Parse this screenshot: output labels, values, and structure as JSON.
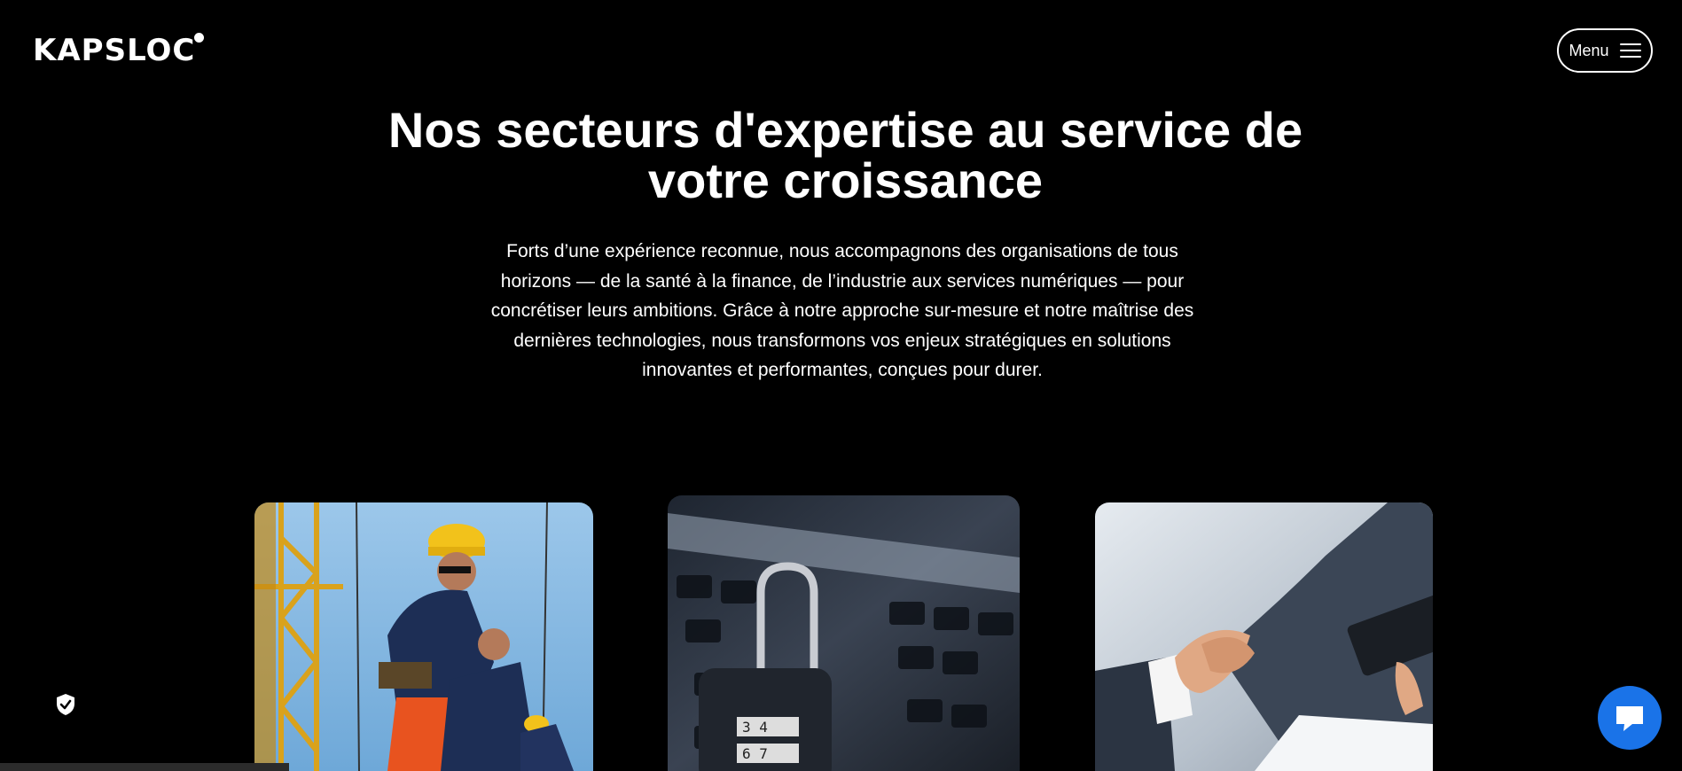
{
  "header": {
    "logo_text": "KAPSLOC",
    "menu_label": "Menu"
  },
  "hero": {
    "title_line1": "Nos secteurs d'expertise au service de",
    "title_line2": "votre croissance",
    "intro": "Forts d’une expérience reconnue, nous accompagnons des organisations de tous horizons — de la santé à la finance, de l’industrie aux services numériques — pour concrétiser leurs ambitions. Grâce à notre approche sur-mesure et notre maîtrise des dernières technologies, nous transformons vos enjeux stratégiques en solutions innovantes et performantes, conçues pour durer."
  },
  "cards": [
    {
      "image": "construction-workers-crane-photo"
    },
    {
      "image": "padlock-on-laptop-keyboard-photo"
    },
    {
      "image": "business-handshake-photo"
    }
  ],
  "widgets": {
    "privacy_icon": "shield-check-icon",
    "chat_icon": "chat-bubble-icon",
    "accent_color": "#1a73e8"
  }
}
